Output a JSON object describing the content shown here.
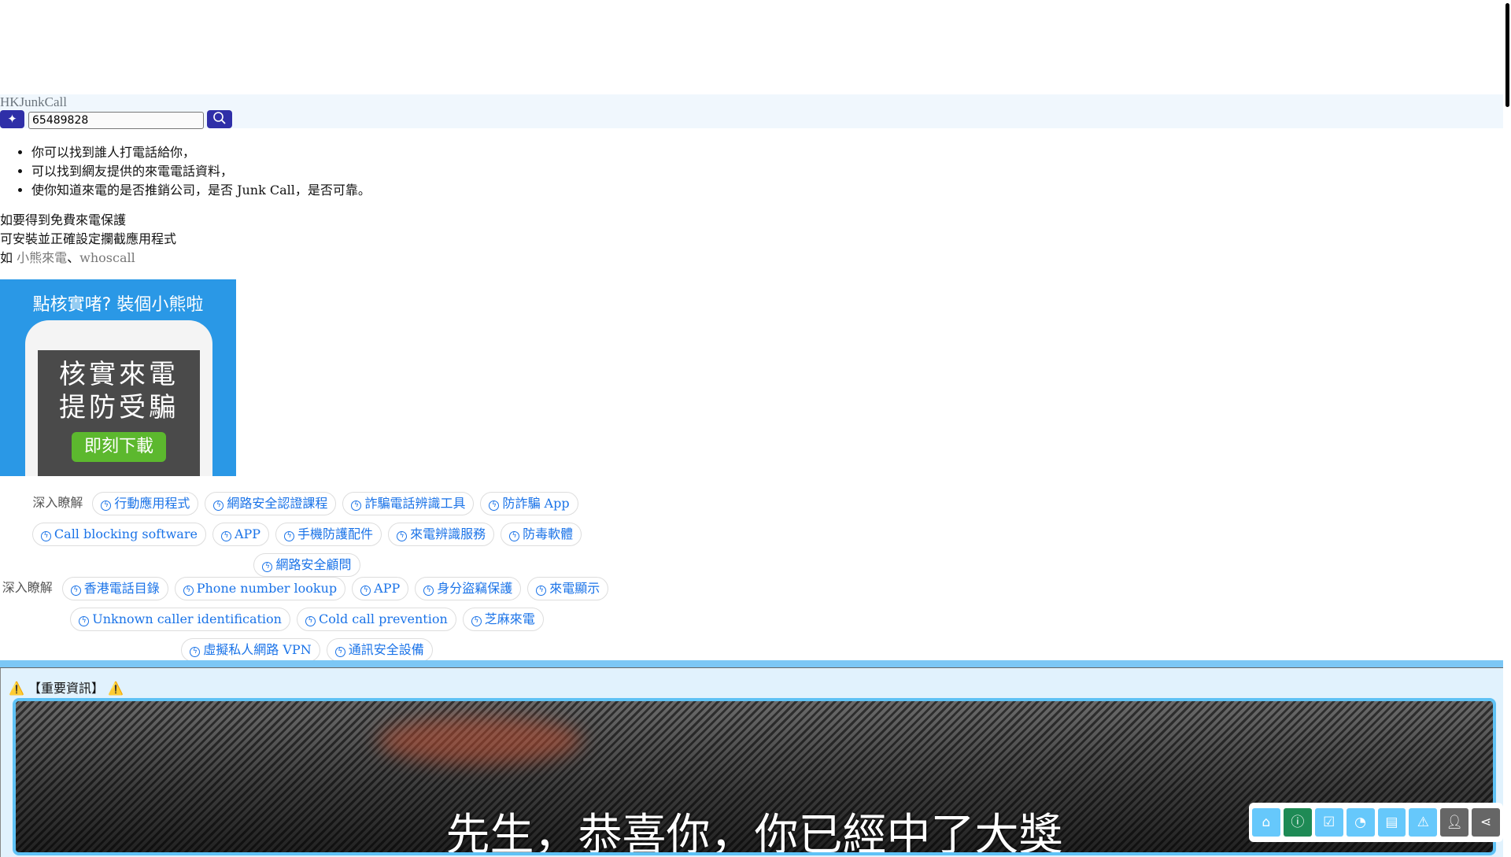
{
  "header": {
    "brand": "HKJunkCall",
    "search_value": "65489828"
  },
  "intro": [
    "你可以找到誰人打電話給你，",
    "可以找到網友提供的來電電話資料，",
    "使你知道來電的是否推銷公司，是否 Junk Call，是否可靠。"
  ],
  "protect": {
    "line1": "如要得到免費來電保護",
    "line2": "可安裝並正確設定攔截應用程式",
    "line3_prefix": "如",
    "link1": "小熊來電",
    "sep": "、",
    "link2": "whoscall"
  },
  "promo": {
    "title": "點核實啫? 裝個小熊啦",
    "line1": "核實來電",
    "line2": "提防受騙",
    "download": "即刻下載"
  },
  "tags1": {
    "label": "深入瞭解",
    "items": [
      "行動應用程式",
      "網路安全認證課程",
      "詐騙電話辨識工具",
      "防詐騙 App",
      "Call blocking software",
      "APP",
      "手機防護配件",
      "來電辨識服務",
      "防毒軟體",
      "網路安全顧問"
    ]
  },
  "tags2": {
    "label": "深入瞭解",
    "items": [
      "香港電話目錄",
      "Phone number lookup",
      "APP",
      "身分盜竊保護",
      "來電顯示",
      "Unknown caller identification",
      "Cold call prevention",
      "芝麻來電",
      "虛擬私人網路 VPN",
      "通訊安全設備"
    ]
  },
  "notice": {
    "title": "【重要資訊】",
    "caption": "先生，恭喜你，你已經中了大獎"
  },
  "toolbar": [
    "home-icon",
    "info-icon",
    "checklist-icon",
    "pie-chart-icon",
    "comment-icon",
    "warning-icon",
    "user-icon",
    "share-icon"
  ]
}
